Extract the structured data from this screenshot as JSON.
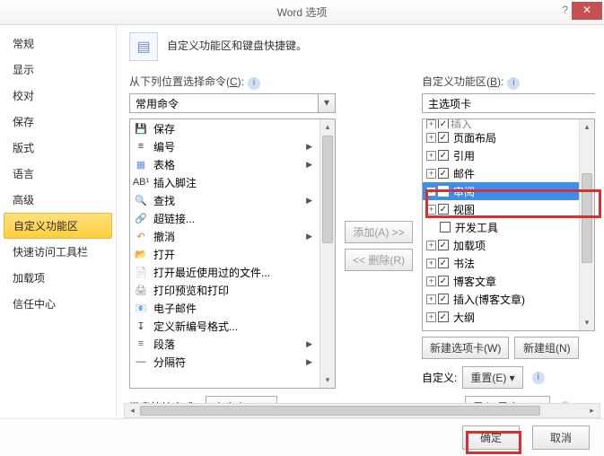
{
  "title": "Word 选项",
  "nav": [
    "常规",
    "显示",
    "校对",
    "保存",
    "版式",
    "语言",
    "高级",
    "自定义功能区",
    "快速访问工具栏",
    "加载项",
    "信任中心"
  ],
  "nav_active": 7,
  "header": "自定义功能区和键盘快捷键。",
  "left": {
    "label_pre": "从下列位置选择命令(",
    "label_u": "C",
    "label_post": "):",
    "combo": "常用命令",
    "items": [
      {
        "icon": "💾",
        "t": "保存",
        "arr": false,
        "c": "#4a6fa5"
      },
      {
        "icon": "≡",
        "t": "编号",
        "arr": true,
        "c": "#3a3a3a"
      },
      {
        "icon": "▦",
        "t": "表格",
        "arr": true,
        "c": "#6a8ed4"
      },
      {
        "icon": "AB¹",
        "t": "插入脚注",
        "arr": false,
        "c": "#3a3a3a"
      },
      {
        "icon": "🔍",
        "t": "查找",
        "arr": true,
        "c": "#c49a3a"
      },
      {
        "icon": "🔗",
        "t": "超链接...",
        "arr": false,
        "c": "#5aa0d8"
      },
      {
        "icon": "↶",
        "t": "撤消",
        "arr": true,
        "c": "#d08a2a"
      },
      {
        "icon": "📂",
        "t": "打开",
        "arr": false,
        "c": "#d8b23a"
      },
      {
        "icon": "📄",
        "t": "打开最近使用过的文件...",
        "arr": false,
        "c": "#888"
      },
      {
        "icon": "🖨",
        "t": "打印预览和打印",
        "arr": false,
        "c": "#888"
      },
      {
        "icon": "📧",
        "t": "电子邮件",
        "arr": false,
        "c": "#d8b23a"
      },
      {
        "icon": "↧",
        "t": "定义新编号格式...",
        "arr": false,
        "c": "#3a3a3a"
      },
      {
        "icon": "≡",
        "t": "段落",
        "arr": true,
        "c": "#4a6fa5"
      },
      {
        "icon": "—",
        "t": "分隔符",
        "arr": true,
        "c": "#3a3a3a"
      }
    ]
  },
  "mid": {
    "add": "添加(A) >>",
    "remove": "<< 删除(R)"
  },
  "right": {
    "label_pre": "自定义功能区(",
    "label_u": "B",
    "label_post": "):",
    "combo": "主选项卡",
    "tree": [
      {
        "exp": "+",
        "chk": true,
        "t": "页面布局",
        "sel": false,
        "partial": true
      },
      {
        "exp": "+",
        "chk": true,
        "t": "引用",
        "sel": false
      },
      {
        "exp": "+",
        "chk": true,
        "t": "邮件",
        "sel": false
      },
      {
        "exp": "+",
        "chk": true,
        "t": "审阅",
        "sel": true
      },
      {
        "exp": "+",
        "chk": true,
        "t": "视图",
        "sel": false
      },
      {
        "exp": "",
        "chk": false,
        "t": "开发工具",
        "sel": false
      },
      {
        "exp": "+",
        "chk": true,
        "t": "加载项",
        "sel": false
      },
      {
        "exp": "+",
        "chk": true,
        "t": "书法",
        "sel": false
      },
      {
        "exp": "+",
        "chk": true,
        "t": "博客文章",
        "sel": false
      },
      {
        "exp": "+",
        "chk": true,
        "t": "插入(博客文章)",
        "sel": false
      },
      {
        "exp": "+",
        "chk": true,
        "t": "大纲",
        "sel": false
      }
    ],
    "btns": {
      "newtab": "新建选项卡(W)",
      "newgroup": "新建组(N)"
    },
    "custom_label": "自定义:",
    "reset": "重置(E) ▾",
    "import": "导入/导出(P) ▾"
  },
  "kb": {
    "label": "键盘快捷方式:",
    "btn": "自定义(T)..."
  },
  "footer": {
    "ok": "确定",
    "cancel": "取消"
  }
}
